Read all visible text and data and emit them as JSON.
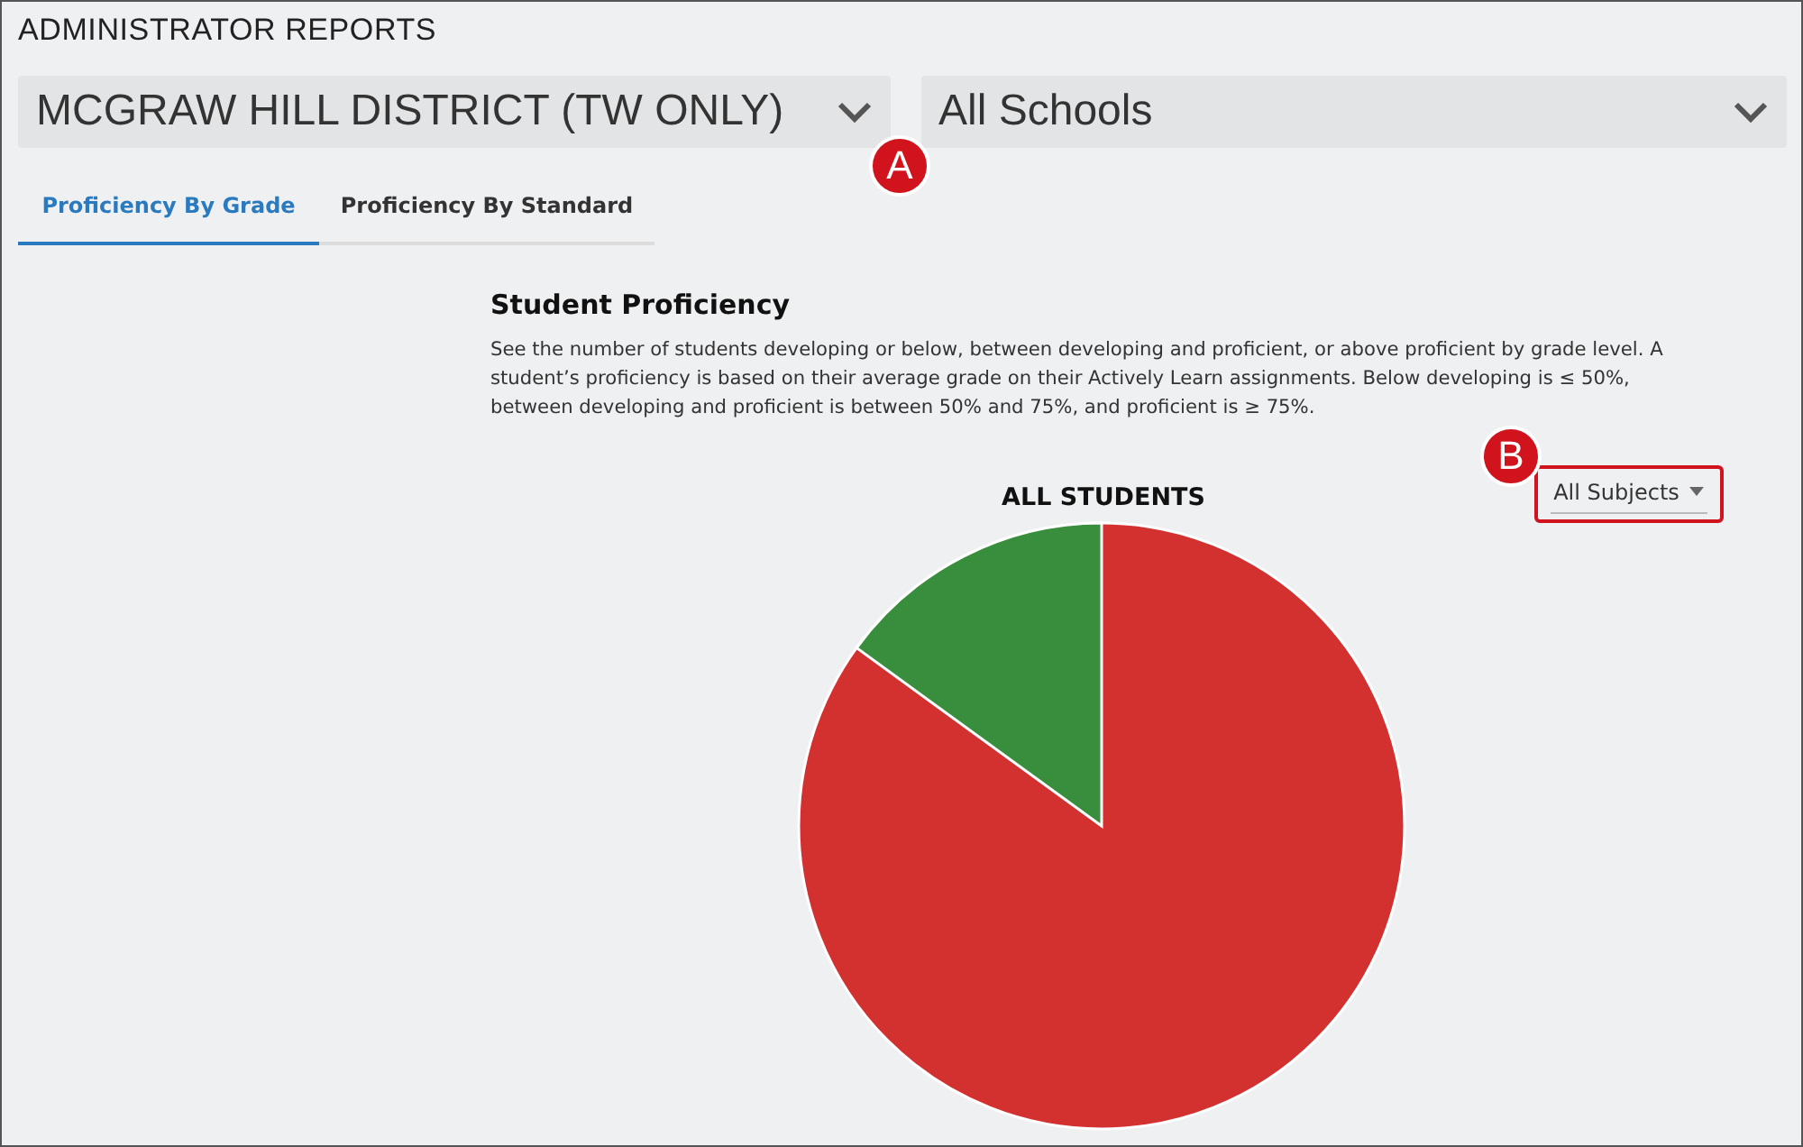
{
  "page_title": "ADMINISTRATOR REPORTS",
  "filters": [
    {
      "value": "MCGRAW HILL DISTRICT (TW ONLY)",
      "callout": "A"
    },
    {
      "value": "All Schools"
    }
  ],
  "tabs": [
    {
      "label": "Proficiency By Grade",
      "selected": true
    },
    {
      "label": "Proficiency By Standard",
      "selected": false
    }
  ],
  "section": {
    "title": "Student Proficiency",
    "description": "See the number of students developing or below, between developing and proficient, or above proficient by grade level. A student’s proficiency is based on their average grade on their Actively Learn assignments. Below developing is ≤ 50%, between developing and proficient is between 50% and 75%, and proficient is ≥ 75%.",
    "chart_title": "ALL STUDENTS",
    "subject_filter": {
      "value": "All Subjects",
      "callout": "B"
    }
  }
}
